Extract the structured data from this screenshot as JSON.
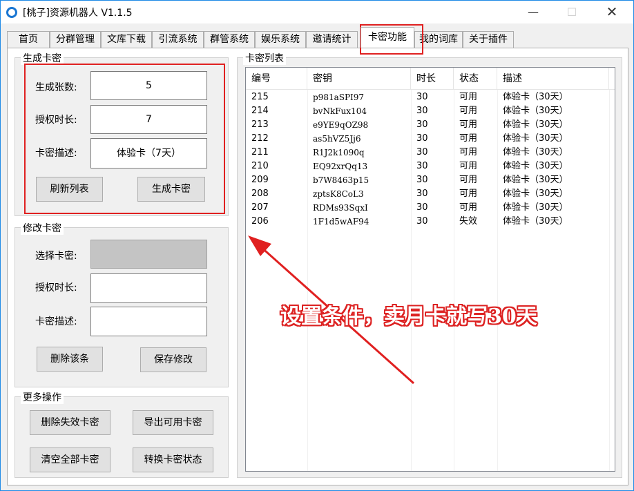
{
  "window": {
    "title": "[桃子]资源机器人 V1.1.5",
    "min_glyph": "—",
    "max_glyph": "☐",
    "close_glyph": "✕"
  },
  "tabs": [
    "首页",
    "分群管理",
    "文库下载",
    "引流系统",
    "群管系统",
    "娱乐系统",
    "邀请统计",
    "卡密功能",
    "我的词库",
    "关于插件"
  ],
  "active_tab": "卡密功能",
  "generate": {
    "title": "生成卡密",
    "count_label": "生成张数:",
    "count_value": "5",
    "duration_label": "授权时长:",
    "duration_value": "7",
    "desc_label": "卡密描述:",
    "desc_value": "体验卡（7天）",
    "refresh_button": "刷新列表",
    "generate_button": "生成卡密"
  },
  "modify": {
    "title": "修改卡密",
    "select_label": "选择卡密:",
    "select_value": "",
    "duration_label": "授权时长:",
    "duration_value": "",
    "desc_label": "卡密描述:",
    "desc_value": "",
    "delete_button": "删除该条",
    "save_button": "保存修改"
  },
  "more": {
    "title": "更多操作",
    "delete_invalid_button": "删除失效卡密",
    "export_valid_button": "导出可用卡密",
    "clear_all_button": "清空全部卡密",
    "toggle_status_button": "转换卡密状态"
  },
  "card_list": {
    "title": "卡密列表",
    "columns": [
      "编号",
      "密钥",
      "时长",
      "状态",
      "描述"
    ],
    "rows": [
      [
        "215",
        "p981aSPI97",
        "30",
        "可用",
        "体验卡（30天）"
      ],
      [
        "214",
        "bvNkFux104",
        "30",
        "可用",
        "体验卡（30天）"
      ],
      [
        "213",
        "e9YE9qOZ98",
        "30",
        "可用",
        "体验卡（30天）"
      ],
      [
        "212",
        "as5hVZ5Jj6",
        "30",
        "可用",
        "体验卡（30天）"
      ],
      [
        "211",
        "R1J2k1090q",
        "30",
        "可用",
        "体验卡（30天）"
      ],
      [
        "210",
        "EQ92xrQq13",
        "30",
        "可用",
        "体验卡（30天）"
      ],
      [
        "209",
        "b7W8463p15",
        "30",
        "可用",
        "体验卡（30天）"
      ],
      [
        "208",
        "zptsK8CoL3",
        "30",
        "可用",
        "体验卡（30天）"
      ],
      [
        "207",
        "RDMs93SqxI",
        "30",
        "可用",
        "体验卡（30天）"
      ],
      [
        "206",
        "1F1d5wAF94",
        "30",
        "失效",
        "体验卡（30天）"
      ]
    ]
  },
  "annotation": "设置条件，卖月卡就写30天",
  "colors": {
    "highlight_red": "#e02020",
    "title_accent": "#1976d2"
  }
}
